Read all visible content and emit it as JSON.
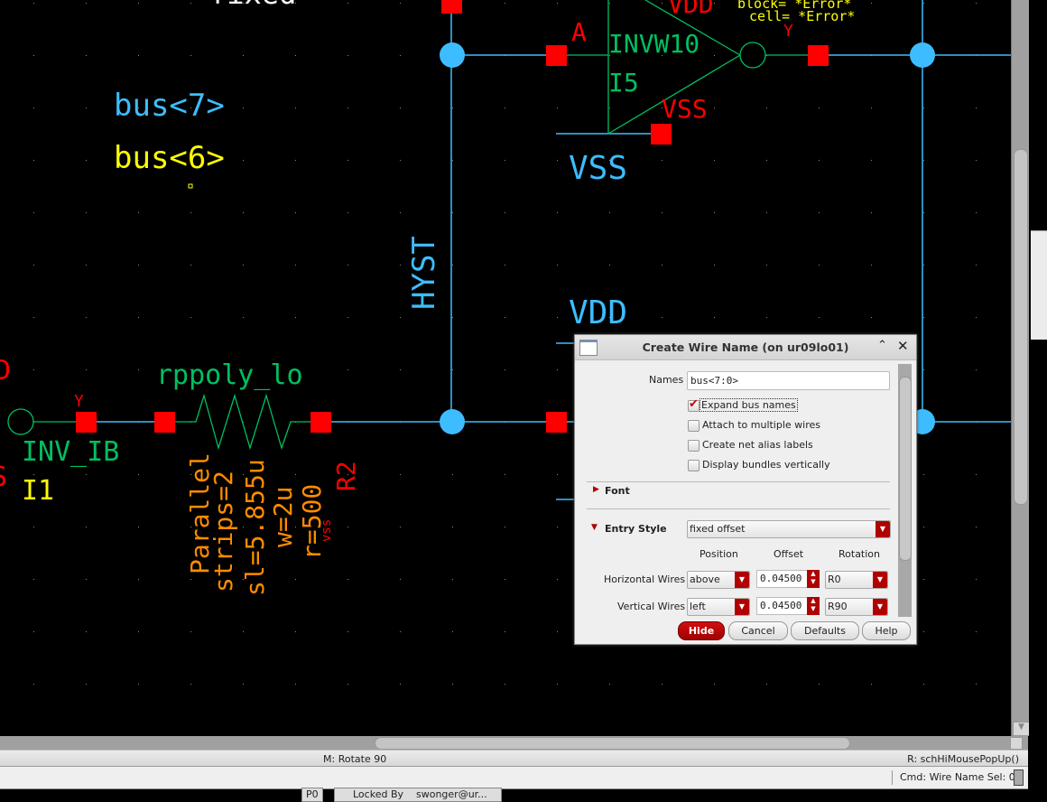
{
  "colors": {
    "background": "#000000",
    "wire": "#3dbdff",
    "pin": "#ff0000",
    "instance": "#00c060",
    "label_yellow": "#ffff00",
    "param_orange": "#ff8c00",
    "accent_red": "#b00000"
  },
  "schematic": {
    "partial_top_label": "fixed",
    "labels": {
      "bus7": "bus<7>",
      "bus6": "bus<6>",
      "hyst": "HYST",
      "vss_net": "VSS",
      "vdd_net": "VDD"
    },
    "inverter_i5": {
      "cell": "INVW10",
      "instance": "I5",
      "pin_a": "A",
      "vdd": "VDD",
      "vss": "VSS",
      "block": "block= *Error*",
      "cell_err": "cell= *Error*",
      "pin_y": "Y"
    },
    "inverter_i1": {
      "cell": "INV_IB",
      "instance": "I1",
      "pin_y": "Y"
    },
    "resistor_r2": {
      "cell": "rppoly_lo",
      "instance": "R2",
      "params": [
        "Parallel",
        "strips=2",
        "sl=5.855u",
        "w=2u",
        "r=500"
      ],
      "terminal": "vss"
    }
  },
  "dialog": {
    "title": "Create Wire Name (on ur09lo01)",
    "names_label": "Names",
    "names_value": "bus<7:0>",
    "checkboxes": [
      {
        "label": "Expand bus names",
        "checked": true
      },
      {
        "label": "Attach to multiple wires",
        "checked": false
      },
      {
        "label": "Create net alias labels",
        "checked": false
      },
      {
        "label": "Display bundles vertically",
        "checked": false
      }
    ],
    "font_section": "Font",
    "entry_style_label": "Entry Style",
    "entry_style_value": "fixed offset",
    "col_headers": [
      "Position",
      "Offset",
      "Rotation"
    ],
    "rows": [
      {
        "label": "Horizontal Wires",
        "position": "above",
        "offset": "0.04500",
        "rotation": "R0"
      },
      {
        "label": "Vertical Wires",
        "position": "left",
        "offset": "0.04500",
        "rotation": "R90"
      }
    ],
    "buttons": {
      "hide": "Hide",
      "cancel": "Cancel",
      "defaults": "Defaults",
      "help": "Help"
    }
  },
  "status": {
    "mouse_middle": "M: Rotate 90",
    "mouse_right": "R: schHiMousePopUp()",
    "cmd": "Cmd: Wire Name  Sel: 0"
  },
  "taskbar": {
    "item1": "P0",
    "item2": "Locked By",
    "item3": "swonger@ur..."
  }
}
